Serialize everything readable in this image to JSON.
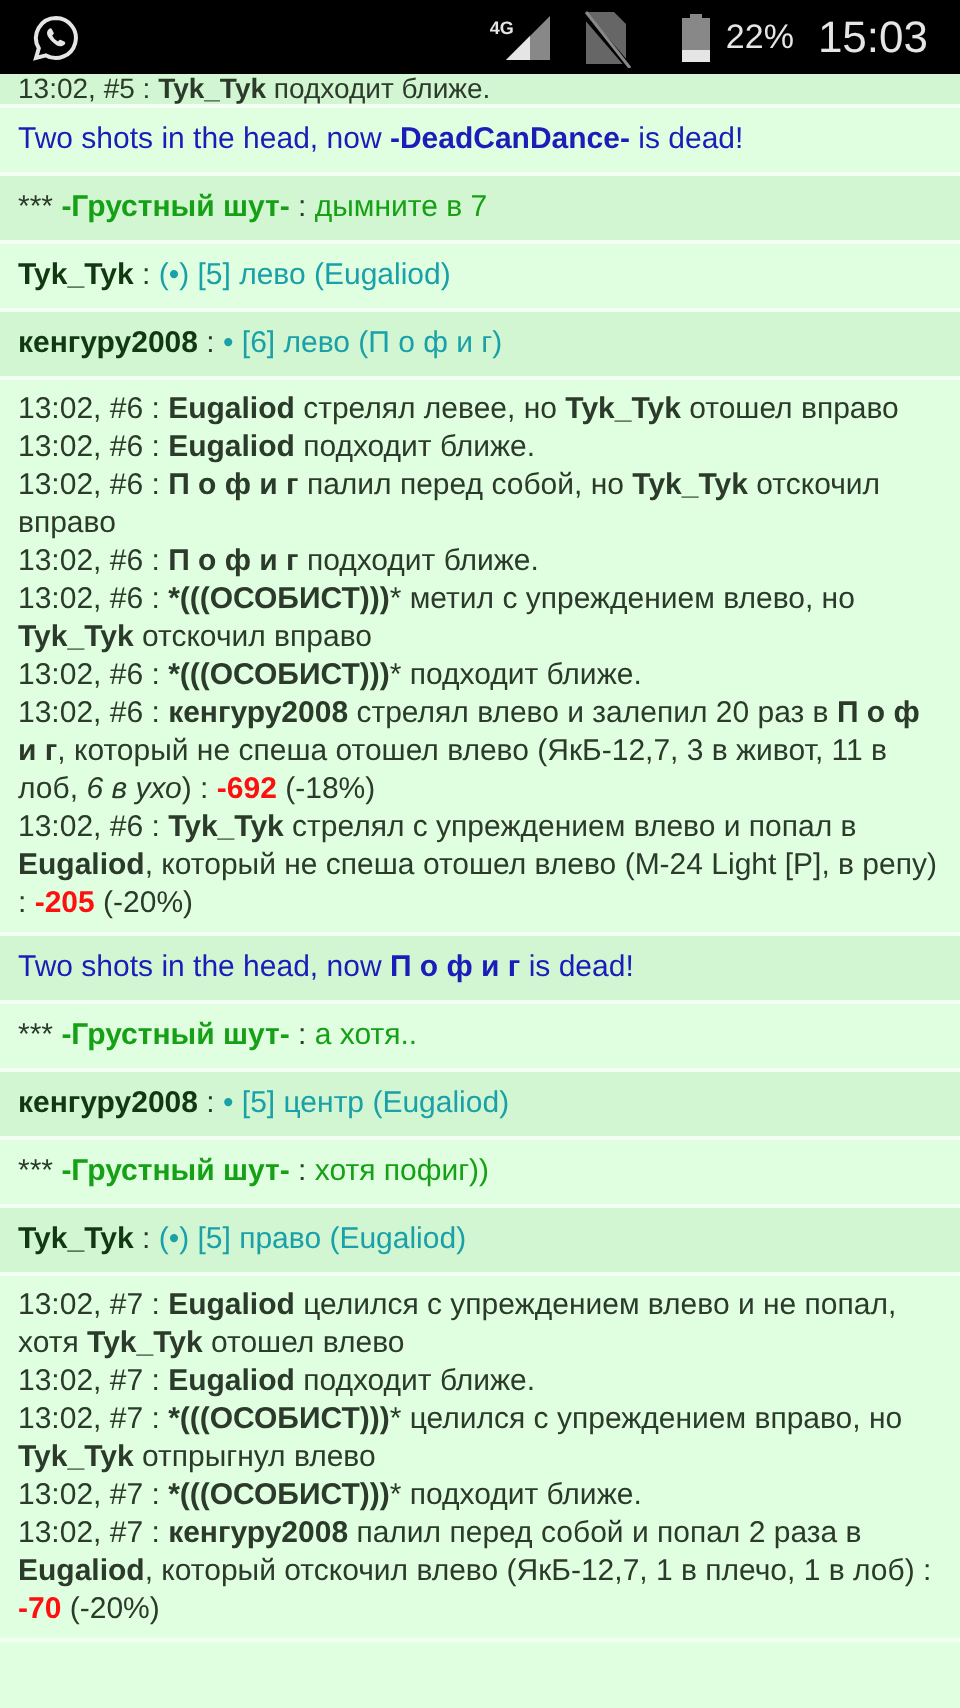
{
  "status_bar": {
    "battery": "22%",
    "time": "15:03",
    "network": "4G"
  },
  "entries": [
    {
      "kind": "log",
      "lines": [
        {
          "text": "13:02, #5 : **Tyk_Tyk** подходит ближе."
        }
      ]
    },
    {
      "kind": "kill",
      "text": "Two shots in the head, now **-DeadCanDance-** is dead!"
    },
    {
      "kind": "chat",
      "prefix": "***",
      "name": "-Грустный шут-",
      "sep": ":",
      "message": "дымните в 7"
    },
    {
      "kind": "move",
      "name": "Tyk_Tyk",
      "sep": ":",
      "message": "(•) [5] лево (Eugaliod)"
    },
    {
      "kind": "move",
      "name": "кенгуру2008",
      "sep": ":",
      "message": "• [6] лево (П о ф и г)"
    },
    {
      "kind": "log",
      "lines": [
        {
          "text": "13:02, #6 : **Eugaliod** стрелял левее, но **Tyk_Tyk** отошел вправо"
        },
        {
          "text": "13:02, #6 : **Eugaliod** подходит ближе."
        },
        {
          "text": "13:02, #6 : **П о ф и г** палил перед собой, но **Tyk_Tyk** отскочил вправо"
        },
        {
          "text": "13:02, #6 : **П о ф и г** подходит ближе."
        },
        {
          "text": "13:02, #6 : ***(((ОСОБИСТ)))*** метил с упреждением влево, но **Tyk_Tyk** отскочил вправо"
        },
        {
          "text": "13:02, #6 : ***(((ОСОБИСТ)))*** подходит ближе."
        },
        {
          "text": "13:02, #6 : **кенгуру2008** стрелял влево и залепил 20 раз в **П о ф и г**, который не спеша отошел влево (ЯкБ-12,7, 3 в живот, 11 в лоб, *6 в ухо*) :",
          "damage": "-692",
          "percent": "(-18%)"
        },
        {
          "text": "13:02, #6 : **Tyk_Tyk** стрелял с упреждением влево и попал в **Eugaliod**, который не спеша отошел влево (M-24 Light [P], в репу) :",
          "damage": "-205",
          "percent": "(-20%)"
        }
      ]
    },
    {
      "kind": "kill",
      "text": "Two shots in the head, now **П о ф и г** is dead!"
    },
    {
      "kind": "chat",
      "prefix": "***",
      "name": "-Грустный шут-",
      "sep": ":",
      "message": "а хотя.."
    },
    {
      "kind": "move",
      "name": "кенгуру2008",
      "sep": ":",
      "message": "• [5] центр (Eugaliod)"
    },
    {
      "kind": "chat",
      "prefix": "***",
      "name": "-Грустный шут-",
      "sep": ":",
      "message": "хотя пофиг))"
    },
    {
      "kind": "move",
      "name": "Tyk_Tyk",
      "sep": ":",
      "message": "(•) [5] право (Eugaliod)"
    },
    {
      "kind": "log",
      "lines": [
        {
          "text": "13:02, #7 : **Eugaliod** целился с упреждением влево и не попал, хотя **Tyk_Tyk** отошел влево"
        },
        {
          "text": "13:02, #7 : **Eugaliod** подходит ближе."
        },
        {
          "text": "13:02, #7 : ***(((ОСОБИСТ)))*** целился с упреждением вправо, но **Tyk_Tyk** отпрыгнул влево"
        },
        {
          "text": "13:02, #7 : ***(((ОСОБИСТ)))*** подходит ближе."
        },
        {
          "text": "13:02, #7 : **кенгуру2008** палил перед собой и попал 2 раза в **Eugaliod**, который отскочил влево (ЯкБ-12,7, 1 в плечо, 1 в лоб) :",
          "damage": "-70",
          "percent": "(-20%)"
        }
      ]
    }
  ]
}
